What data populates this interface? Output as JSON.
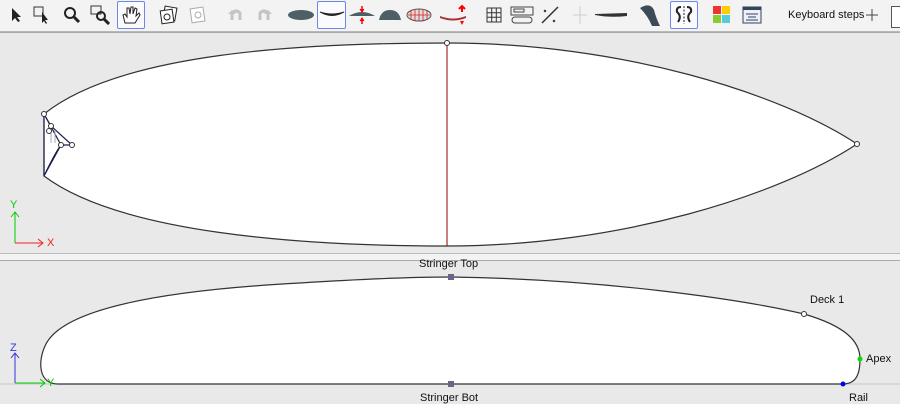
{
  "toolbar": {
    "tools": [
      "select-icon",
      "select-area-icon",
      "zoom-icon",
      "zoom-window-icon",
      "pan-hand-icon",
      "copy-image-icon",
      "paste-image-icon",
      "undo-icon",
      "redo-icon",
      "outline-view-icon",
      "rocker-view-icon",
      "thickness-view-icon",
      "slice-view-icon",
      "3d-view-icon",
      "rocker-bottom-icon",
      "grid-icon",
      "layout-icon",
      "measure-icon",
      "ruler-icon",
      "board-side-icon",
      "fin-icon",
      "symmetry-icon",
      "colors-icon",
      "properties-icon"
    ],
    "keyboard_steps_label": "Keyboard steps"
  },
  "outline_view": {
    "axis_y": "Y",
    "axis_x": "X"
  },
  "profile_view": {
    "axis_z": "Z",
    "axis_y": "Y",
    "stringer_top": "Stringer Top",
    "stringer_bot": "Stringer Bot",
    "deck": "Deck 1",
    "apex": "Apex",
    "rail": "Rail"
  },
  "colors": {
    "selected_border": "#6d86e8",
    "stringer": "#8b0000",
    "apex": "#00cc00",
    "rail": "#0000ee"
  }
}
